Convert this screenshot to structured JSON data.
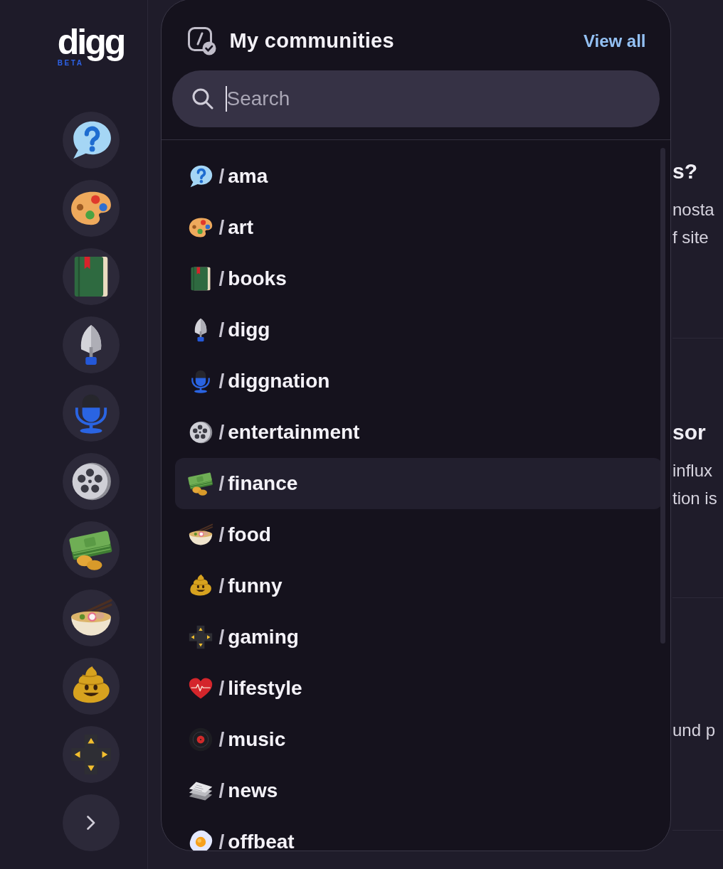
{
  "sidebar": {
    "logo": {
      "wordmark": "digg",
      "badge": "BETA"
    },
    "communities": [
      {
        "kind": "bubble"
      },
      {
        "kind": "palette"
      },
      {
        "kind": "book"
      },
      {
        "kind": "shovel"
      },
      {
        "kind": "microphone"
      },
      {
        "kind": "reel"
      },
      {
        "kind": "money"
      },
      {
        "kind": "noodles"
      },
      {
        "kind": "poop"
      },
      {
        "kind": "dpad"
      }
    ]
  },
  "feed": {
    "stories": [
      {
        "title": "s?",
        "lines": [
          "nosta",
          "f site"
        ]
      },
      {
        "title": "sor",
        "lines": [
          "influx",
          "tion is"
        ]
      },
      {
        "lines": [
          "und p"
        ]
      }
    ]
  },
  "community_panel": {
    "title": "My communities",
    "view_all": "View all",
    "search": {
      "placeholder": "Search"
    },
    "communities": [
      {
        "kind": "bubble",
        "prefix": "/",
        "name": "ama",
        "selected": false
      },
      {
        "kind": "palette",
        "prefix": "/",
        "name": "art",
        "selected": false
      },
      {
        "kind": "book",
        "prefix": "/",
        "name": "books",
        "selected": false
      },
      {
        "kind": "shovel",
        "prefix": "/",
        "name": "digg",
        "selected": false
      },
      {
        "kind": "microphone",
        "prefix": "/",
        "name": "diggnation",
        "selected": false
      },
      {
        "kind": "reel",
        "prefix": "/",
        "name": "entertainment",
        "selected": false
      },
      {
        "kind": "money",
        "prefix": "/",
        "name": "finance",
        "selected": true
      },
      {
        "kind": "noodles",
        "prefix": "/",
        "name": "food",
        "selected": false
      },
      {
        "kind": "poop",
        "prefix": "/",
        "name": "funny",
        "selected": false
      },
      {
        "kind": "dpad",
        "prefix": "/",
        "name": "gaming",
        "selected": false
      },
      {
        "kind": "heart",
        "prefix": "/",
        "name": "lifestyle",
        "selected": false
      },
      {
        "kind": "record",
        "prefix": "/",
        "name": "music",
        "selected": false
      },
      {
        "kind": "newspaper",
        "prefix": "/",
        "name": "news",
        "selected": false
      },
      {
        "kind": "egg",
        "prefix": "/",
        "name": "offbeat",
        "selected": false
      }
    ]
  }
}
